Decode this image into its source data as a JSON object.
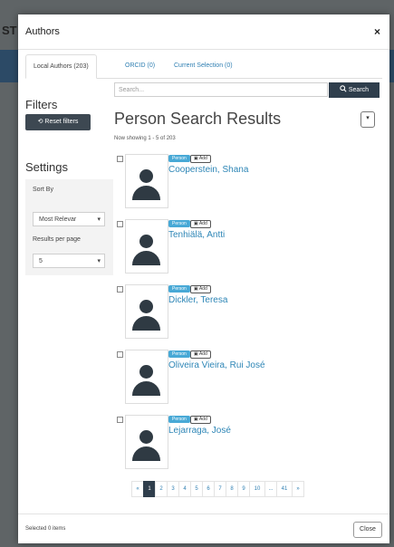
{
  "backdrop": {
    "label": "ST"
  },
  "modal": {
    "title": "Authors",
    "close_icon": "×"
  },
  "tabs": [
    {
      "label": "Local Authors (203)",
      "active": true
    },
    {
      "label": "ORCID (0)"
    },
    {
      "label": "Current Selection (0)"
    }
  ],
  "search": {
    "placeholder": "Search...",
    "button_label": "Search",
    "button_icon": "search-icon"
  },
  "filters": {
    "title": "Filters",
    "reset_label": "Reset filters",
    "reset_icon": "undo-icon"
  },
  "results": {
    "title": "Person Search Results",
    "showing": "Now showing 1 - 5 of 203",
    "items": [
      {
        "badge": "Person",
        "add_label": "Add",
        "name": "Cooperstein, Shana"
      },
      {
        "badge": "Person",
        "add_label": "Add",
        "name": "Tenhiälä, Antti"
      },
      {
        "badge": "Person",
        "add_label": "Add",
        "name": "Dickler, Teresa"
      },
      {
        "badge": "Person",
        "add_label": "Add",
        "name": "Oliveira Vieira, Rui José"
      },
      {
        "badge": "Person",
        "add_label": "Add",
        "name": "Lejarraga, José"
      }
    ]
  },
  "settings": {
    "title": "Settings",
    "sort_by_label": "Sort By",
    "sort_by_value": "Most Relevar",
    "per_page_label": "Results per page",
    "per_page_value": "5"
  },
  "pagination": {
    "prev": "«",
    "pages": [
      "1",
      "2",
      "3",
      "4",
      "5",
      "6",
      "7",
      "8",
      "9",
      "10",
      "...",
      "41"
    ],
    "next": "»",
    "current": "1"
  },
  "footer": {
    "selected_text": "Selected 0 items",
    "close_label": "Close"
  },
  "colors": {
    "accent": "#2f7fb2",
    "dark_button": "#2f3e4c",
    "badge": "#48a9d6",
    "name_link": "#2e86b6"
  }
}
